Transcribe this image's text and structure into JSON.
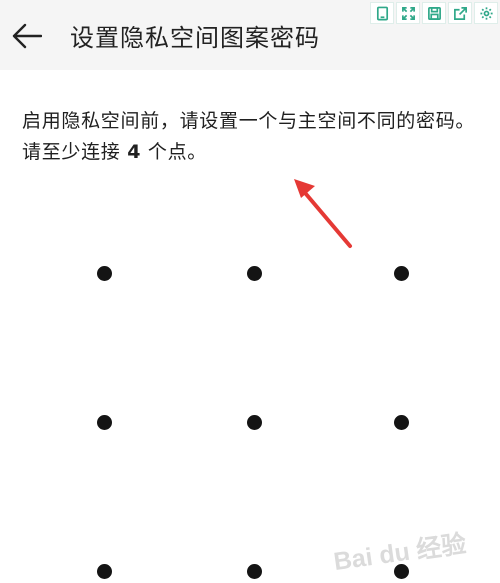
{
  "header": {
    "title": "设置隐私空间图案密码",
    "back_icon": "arrow-left-icon"
  },
  "toolbar": {
    "icons": [
      "tablet-icon",
      "expand-icon",
      "save-icon",
      "share-icon",
      "gear-icon"
    ],
    "accent_color": "#2fa889"
  },
  "instruction": {
    "text_before": "启用隐私空间前，请设置一个与主空间不同的密码。请至少连接 ",
    "count": "4",
    "text_after": " 个点。"
  },
  "pattern": {
    "dot_count": 9,
    "dot_color": "#141414"
  },
  "annotation": {
    "arrow_color": "#e53935"
  },
  "watermark": {
    "text": "Bai du 经验"
  }
}
